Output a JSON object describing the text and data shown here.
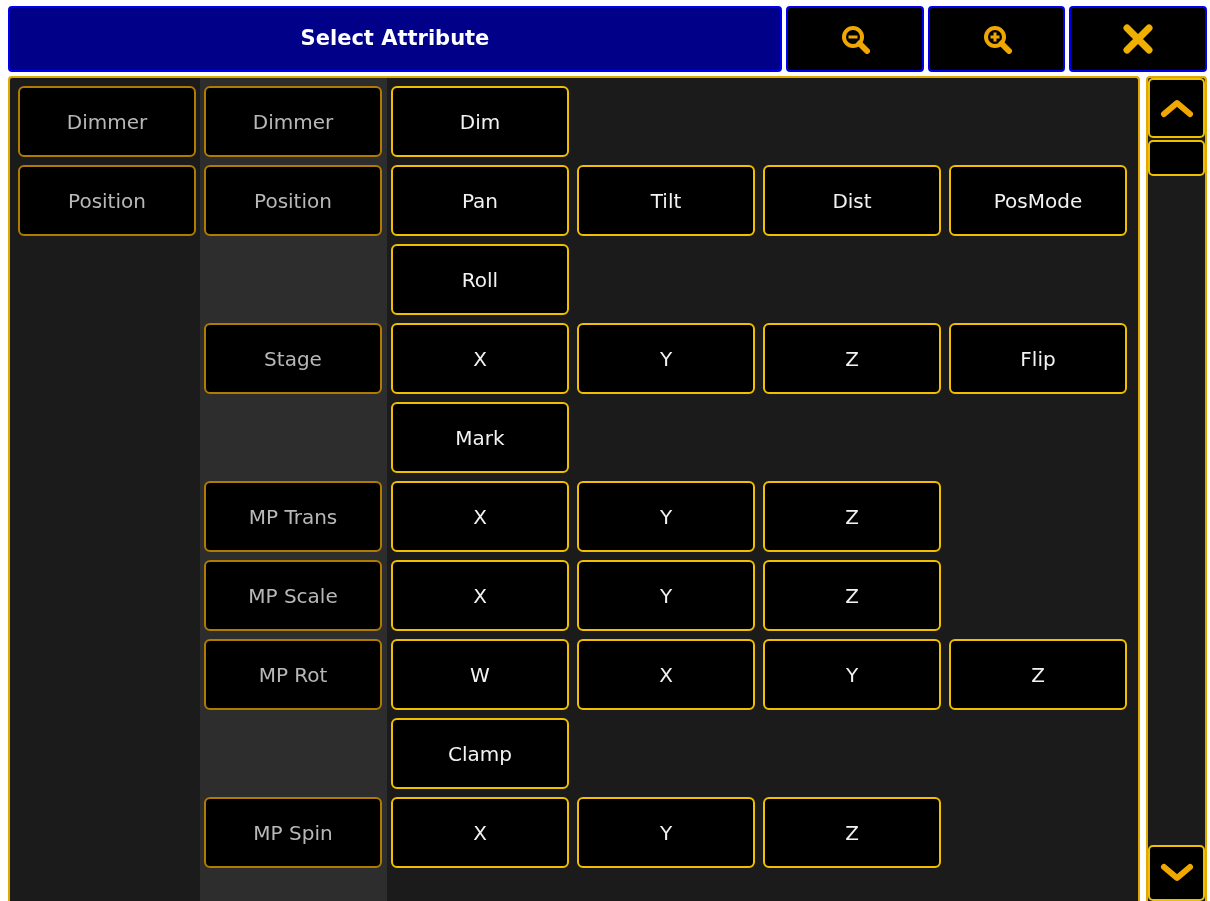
{
  "window": {
    "title": "Select Attribute"
  },
  "toolbar": [
    {
      "kind": "zoom_out"
    },
    {
      "kind": "zoom_in"
    },
    {
      "kind": "close"
    }
  ],
  "rows": [
    {
      "feature_group": "Dimmer",
      "feature": "Dimmer",
      "attributes": [
        "Dim"
      ]
    },
    {
      "feature_group": "Position",
      "feature": "Position",
      "attributes": [
        "Pan",
        "Tilt",
        "Dist",
        "PosMode"
      ]
    },
    {
      "attributes": [
        "Roll"
      ]
    },
    {
      "feature": "Stage",
      "attributes": [
        "X",
        "Y",
        "Z",
        "Flip"
      ]
    },
    {
      "attributes": [
        "Mark"
      ]
    },
    {
      "feature": "MP Trans",
      "attributes": [
        "X",
        "Y",
        "Z"
      ]
    },
    {
      "feature": "MP Scale",
      "attributes": [
        "X",
        "Y",
        "Z"
      ]
    },
    {
      "feature": "MP Rot",
      "attributes": [
        "W",
        "X",
        "Y",
        "Z"
      ]
    },
    {
      "attributes": [
        "Clamp"
      ]
    },
    {
      "feature": "MP Spin",
      "attributes": [
        "X",
        "Y",
        "Z"
      ]
    }
  ]
}
